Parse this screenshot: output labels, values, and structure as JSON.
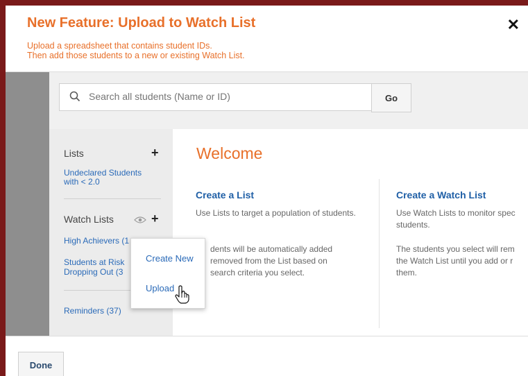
{
  "header": {
    "title": "New Feature: Upload to Watch List",
    "subtitle_line1": "Upload a spreadsheet that contains student IDs.",
    "subtitle_line2": "Then add those students to a new or existing Watch List.",
    "close_glyph": "✕"
  },
  "search": {
    "placeholder": "Search all students (Name or ID)",
    "go_label": "Go"
  },
  "sidebar": {
    "lists_heading": "Lists",
    "lists_items": [
      "Undeclared Students with < 2.0"
    ],
    "watch_lists_heading": "Watch Lists",
    "watch_items": [
      "High Achievers (1",
      "Students at Risk",
      "Dropping Out (3"
    ],
    "reminders": "Reminders (37)",
    "plus_glyph": "+"
  },
  "popup": {
    "items": [
      "Create New",
      "Upload"
    ]
  },
  "main": {
    "welcome": "Welcome",
    "col1": {
      "heading": "Create a List",
      "para1": "Use Lists to target a population of students.",
      "para2_l1": "dents will be automatically added",
      "para2_l2": "removed from the List based on",
      "para2_l3": "search criteria you select."
    },
    "col2": {
      "heading": "Create a Watch List",
      "para1_l1": "Use Watch Lists to monitor spec",
      "para1_l2": "students.",
      "para2_l1": "The students you select will rem",
      "para2_l2": "the Watch List until you add or r",
      "para2_l3": "them."
    }
  },
  "footer": {
    "done_label": "Done"
  },
  "colors": {
    "accent_orange": "#e8702a",
    "link_blue": "#2a6ab8",
    "backdrop": "#7a1a1a"
  }
}
